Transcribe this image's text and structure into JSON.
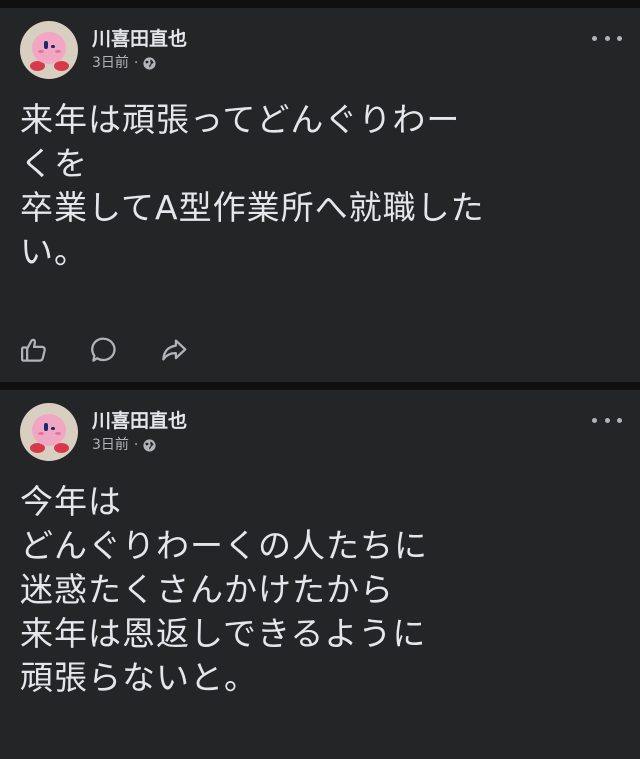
{
  "posts": [
    {
      "author": "川喜田直也",
      "time": "3日前",
      "separator": "·",
      "privacy_icon": "globe-icon",
      "text": "来年は頑張ってどんぐりわー\nくを\n卒業してA型作業所へ就職した\nい。",
      "actions": [
        "like-icon",
        "comment-icon",
        "share-icon"
      ]
    },
    {
      "author": "川喜田直也",
      "time": "3日前",
      "separator": "·",
      "privacy_icon": "globe-icon",
      "text": "今年は\nどんぐりわーくの人たちに\n迷惑たくさんかけたから\n来年は恩返しできるように\n頑張らないと。"
    }
  ],
  "colors": {
    "background": "#0f0f10",
    "card": "#242526",
    "text_primary": "#e4e6eb",
    "text_secondary": "#b0b3b8"
  }
}
